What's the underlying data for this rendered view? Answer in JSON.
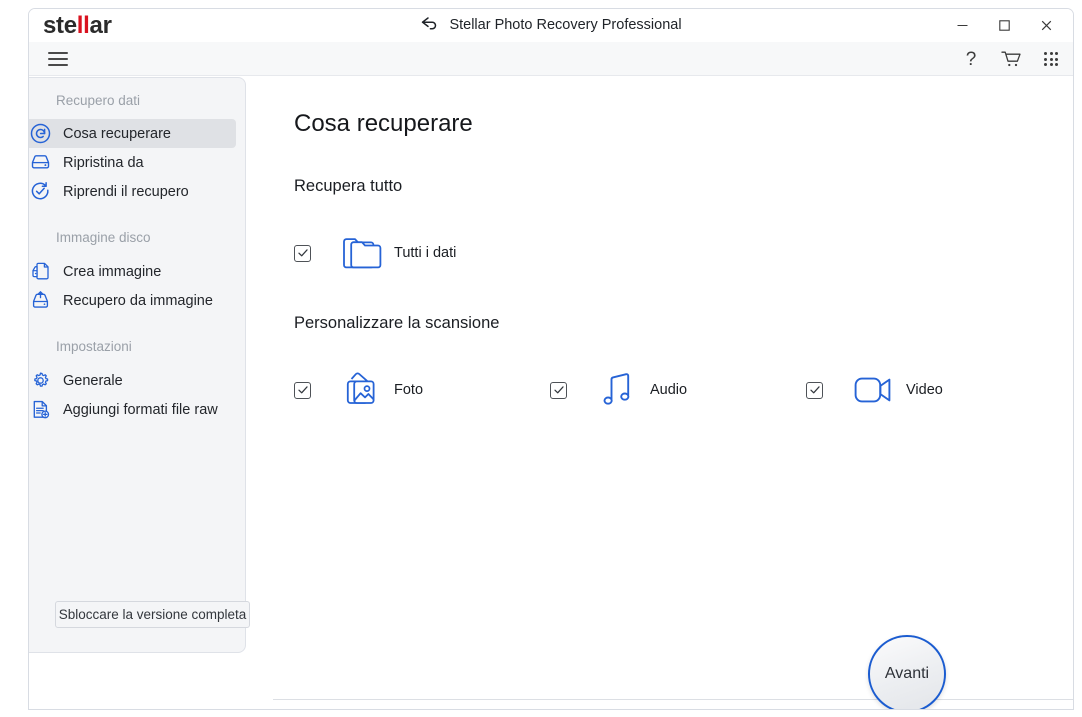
{
  "window": {
    "brand_prefix": "ste",
    "brand_accent": "ll",
    "brand_suffix": "ar",
    "title": "Stellar Photo Recovery Professional",
    "back_icon": "back-arrow-icon",
    "minimize_label": "–",
    "maximize_label": "□",
    "close_label": "✕",
    "accent_color": "#2663d6",
    "brand_red": "#d9121f"
  },
  "toolbar": {
    "menu_icon": "hamburger-icon",
    "help_label": "?",
    "cart_icon": "cart-icon",
    "apps_icon": "apps-grid-icon"
  },
  "sidebar": {
    "groups": [
      {
        "label": "Recupero dati",
        "items": [
          {
            "label": "Cosa recuperare",
            "icon": "refresh-circle-icon",
            "selected": true
          },
          {
            "label": "Ripristina da",
            "icon": "hard-drive-icon",
            "selected": false
          },
          {
            "label": "Riprendi il recupero",
            "icon": "resume-check-icon",
            "selected": false
          }
        ]
      },
      {
        "label": "Immagine disco",
        "items": [
          {
            "label": "Crea immagine",
            "icon": "create-image-icon",
            "selected": false
          },
          {
            "label": "Recupero da immagine",
            "icon": "restore-image-icon",
            "selected": false
          }
        ]
      },
      {
        "label": "Impostazioni",
        "items": [
          {
            "label": "Generale",
            "icon": "gear-icon",
            "selected": false
          },
          {
            "label": "Aggiungi formati file raw",
            "icon": "document-add-icon",
            "selected": false
          }
        ]
      }
    ],
    "unlock_button_label": "Sbloccare la versione completa"
  },
  "main": {
    "page_title": "Cosa recuperare",
    "recover_all": {
      "section_title": "Recupera tutto",
      "option": {
        "label": "Tutti i dati",
        "icon": "folder-icon",
        "checked": true
      }
    },
    "custom_scan": {
      "section_title": "Personalizzare la scansione",
      "options": [
        {
          "label": "Foto",
          "icon": "photos-icon",
          "checked": true
        },
        {
          "label": "Audio",
          "icon": "music-note-icon",
          "checked": true
        },
        {
          "label": "Video",
          "icon": "video-camera-icon",
          "checked": true
        }
      ]
    }
  },
  "footer": {
    "next_button_label": "Avanti"
  }
}
